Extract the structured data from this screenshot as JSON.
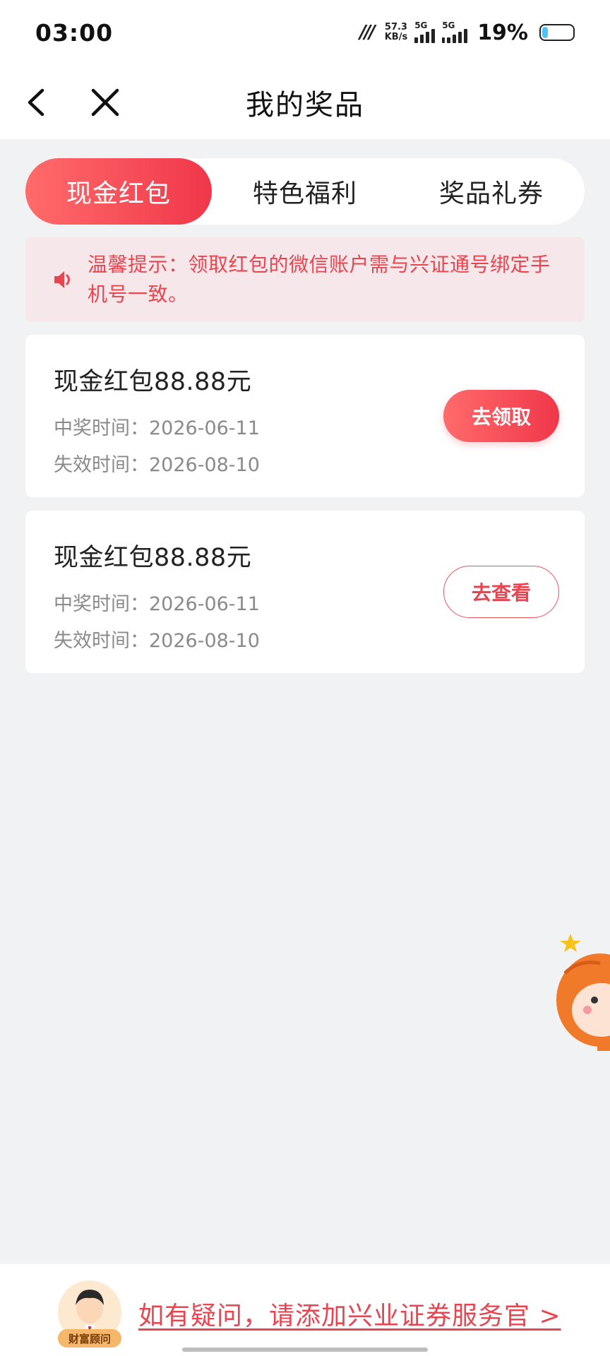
{
  "status_bar": {
    "time": "03:00",
    "net_speed_value": "57.3",
    "net_speed_unit": "KB/s",
    "sim1_label": "5G",
    "sim2_label": "5G",
    "battery_percent": "19%",
    "battery_level": 0.19,
    "icons": [
      "network-speed-icon",
      "signal-icon",
      "battery-icon"
    ]
  },
  "nav": {
    "title": "我的奖品",
    "back_icon": "chevron-left-icon",
    "close_icon": "close-icon"
  },
  "tabs": [
    {
      "label": "现金红包",
      "active": true
    },
    {
      "label": "特色福利",
      "active": false
    },
    {
      "label": "奖品礼券",
      "active": false
    }
  ],
  "notice": {
    "icon": "speaker-icon",
    "text": "温馨提示：领取红包的微信账户需与兴证通号绑定手机号一致。"
  },
  "prizes": [
    {
      "name": "现金红包88.88元",
      "won_time": "中奖时间：2026-06-11",
      "expire_time": "失效时间：2026-08-10",
      "action_label": "去领取"
    },
    {
      "name": "现金红包88.88元",
      "won_time": "中奖时间：2026-06-11",
      "expire_time": "失效时间：2026-08-10",
      "action_label": "去查看"
    }
  ],
  "footer": {
    "advisor_badge": "财富顾问",
    "link_text": "如有疑问，请添加兴业证券服务官 >"
  },
  "colors": {
    "accent": "#f0374a",
    "accent_light": "#ff6b6b",
    "notice_bg": "#f6e8ea",
    "page_bg": "#f1f2f4"
  }
}
